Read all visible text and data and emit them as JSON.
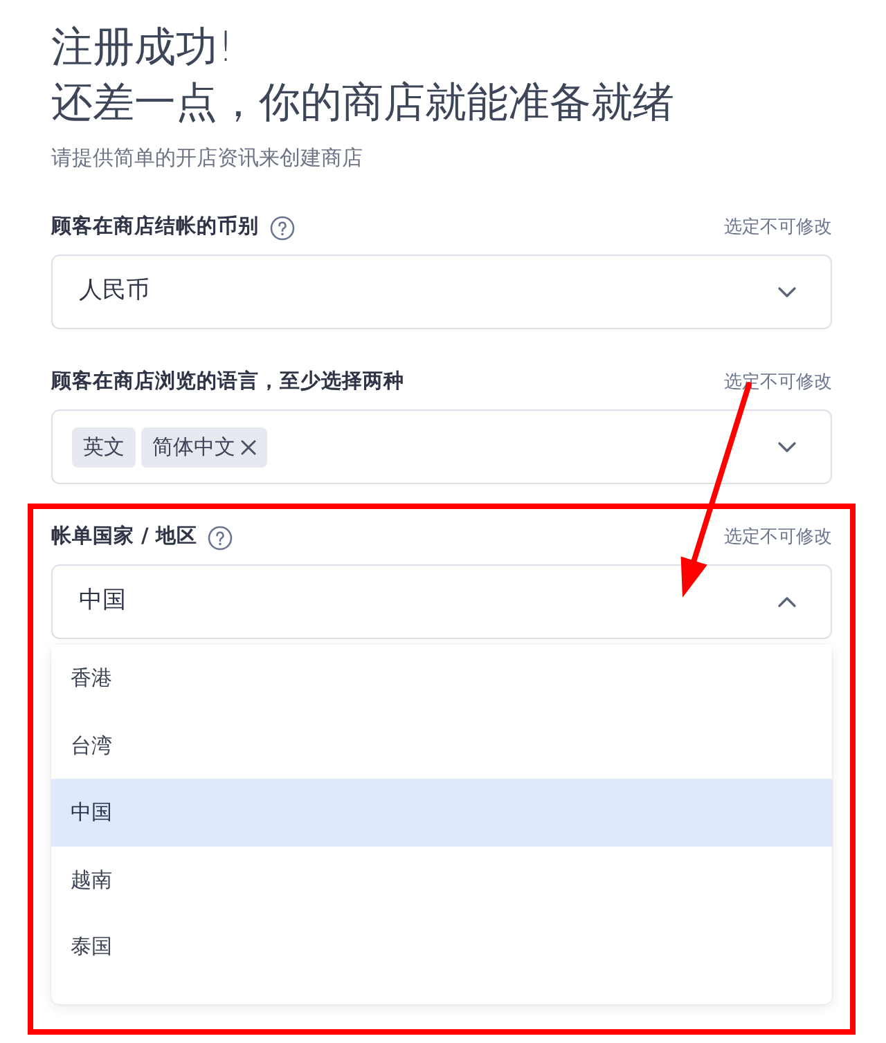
{
  "heading": {
    "title": "注册成功!",
    "subtitle": "还差一点，你的商店就能准备就绪",
    "description": "请提供简单的开店资讯来创建商店"
  },
  "fields": [
    {
      "kind": "select",
      "label": "顾客在商店结帐的币别",
      "help": true,
      "note": "选定不可修改",
      "value": "人民币",
      "expanded": false
    },
    {
      "kind": "multi",
      "label": "顾客在商店浏览的语言，至少选择两种",
      "help": false,
      "note": "选定不可修改",
      "tags": [
        {
          "label": "英文",
          "removable": false
        },
        {
          "label": "简体中文",
          "removable": true
        }
      ],
      "expanded": false
    },
    {
      "kind": "select",
      "label": "帐单国家 / 地区",
      "help": true,
      "note": "选定不可修改",
      "value": "中国",
      "expanded": true,
      "options": [
        {
          "label": "香港",
          "selected": false
        },
        {
          "label": "台湾",
          "selected": false
        },
        {
          "label": "中国",
          "selected": true
        },
        {
          "label": "越南",
          "selected": false
        },
        {
          "label": "泰国",
          "selected": false
        }
      ]
    }
  ],
  "annotation": {
    "frame": true,
    "arrow": true
  }
}
